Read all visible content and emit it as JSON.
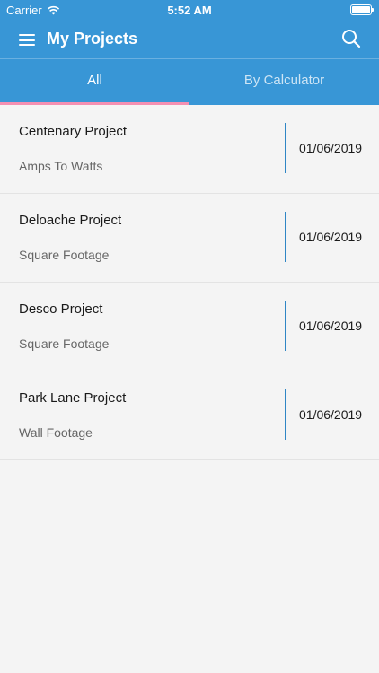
{
  "status": {
    "carrier": "Carrier",
    "time": "5:52 AM"
  },
  "toolbar": {
    "title": "My Projects"
  },
  "tabs": [
    {
      "label": "All",
      "active": true
    },
    {
      "label": "By Calculator",
      "active": false
    }
  ],
  "projects": [
    {
      "name": "Centenary Project",
      "calculator": "Amps To Watts",
      "date": "01/06/2019"
    },
    {
      "name": "Deloache Project",
      "calculator": "Square Footage",
      "date": "01/06/2019"
    },
    {
      "name": "Desco Project",
      "calculator": "Square Footage",
      "date": "01/06/2019"
    },
    {
      "name": "Park Lane Project",
      "calculator": "Wall Footage",
      "date": "01/06/2019"
    }
  ],
  "colors": {
    "primary": "#3896d6",
    "accent": "#f48fb1",
    "divider": "#2f86c5"
  }
}
